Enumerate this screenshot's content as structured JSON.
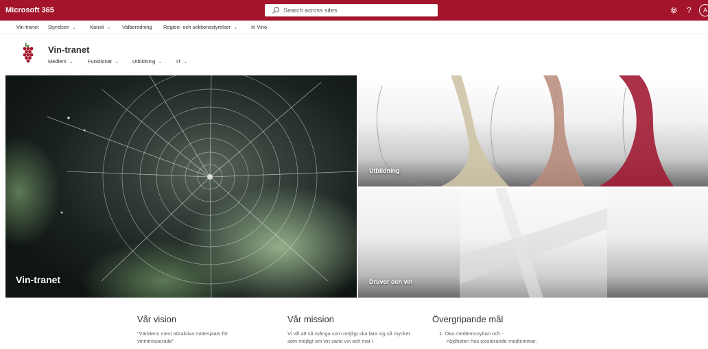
{
  "suite": {
    "title": "Microsoft 365",
    "search_placeholder": "Search across sites",
    "help": "?",
    "avatar": "A",
    "icons": [
      "search-icon",
      "gear-icon"
    ],
    "color": "#a4142a"
  },
  "hubnav": {
    "items": [
      {
        "label": "Vin-tranet"
      },
      {
        "label": "Styrelsen",
        "chevron": "⌄"
      },
      {
        "label": "Kansli",
        "chevron": "⌄"
      },
      {
        "label": "Valberedning"
      },
      {
        "label": "Region- och sektionsstyrelser",
        "chevron": "⌄"
      },
      {
        "label": "In Vino"
      }
    ]
  },
  "site": {
    "title": "Vin-tranet",
    "nav": [
      {
        "label": "Medlem",
        "chevron": "⌄"
      },
      {
        "label": "Funktionär",
        "chevron": "⌄"
      },
      {
        "label": "Utbildning",
        "chevron": "⌄"
      },
      {
        "label": "IT",
        "chevron": "⌄"
      }
    ]
  },
  "hero": {
    "main": "Vin-tranet",
    "top": "Utbildning",
    "bottom": "Druvor och vin"
  },
  "sections": {
    "vision": {
      "title": "Vår vision",
      "text": "\"Världens mest attraktiva mötesplats för vinintresserade\""
    },
    "mission": {
      "title": "Vår mission",
      "text": "Vi vill att så många som möjligt ska lära sig så mycket som möjligt om vin samt vin och mat i"
    },
    "goals": {
      "title": "Övergripande mål",
      "item1_line1": "1. Öka medlemsnyttan och -",
      "item1_line2": "nöjdheten hos existerande medlemmar."
    }
  }
}
